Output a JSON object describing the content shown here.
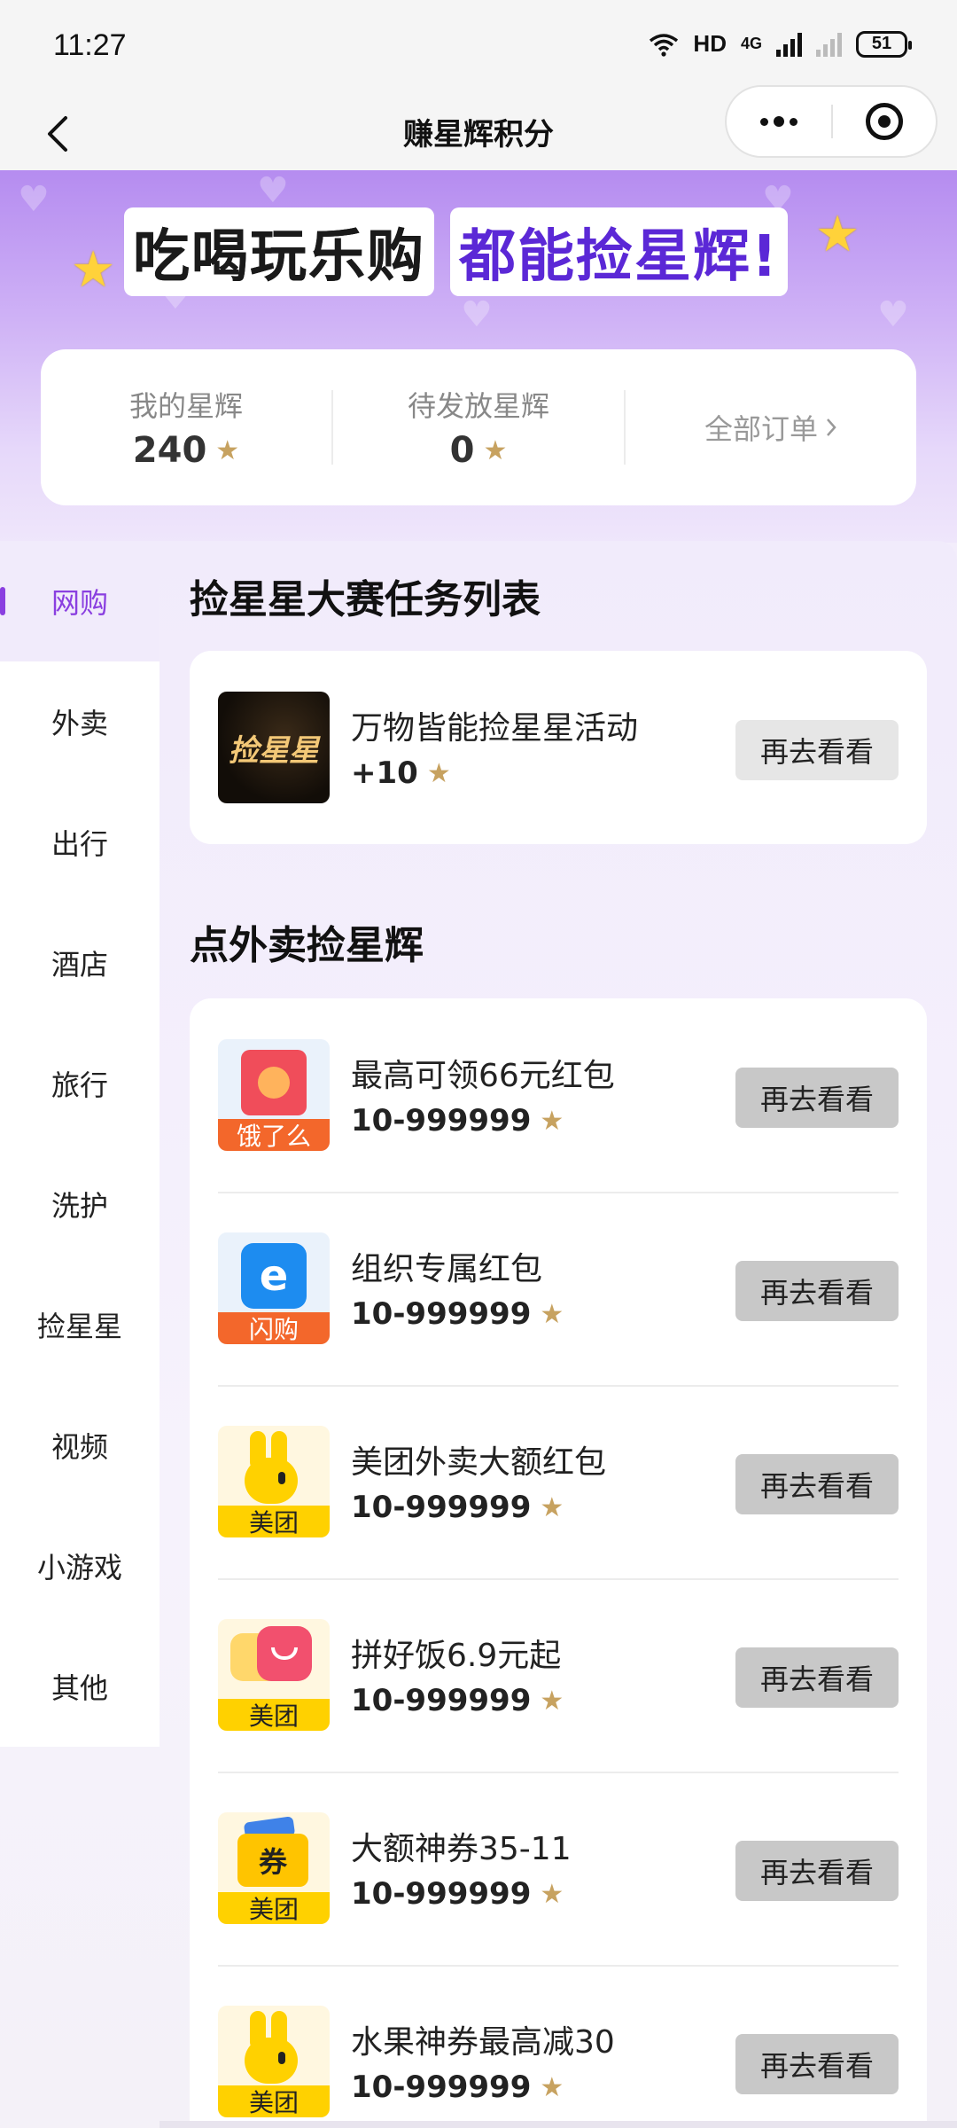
{
  "status_bar": {
    "time": "11:27",
    "network": "HD",
    "network_type": "4G",
    "battery": "51"
  },
  "nav": {
    "title": "赚星辉积分"
  },
  "banner": {
    "title_part1": "吃喝玩乐购",
    "title_part2": "都能捡星辉!"
  },
  "stats": {
    "my_label": "我的星辉",
    "my_value": "240",
    "pending_label": "待发放星辉",
    "pending_value": "0",
    "orders_label": "全部订单"
  },
  "sidebar": {
    "items": [
      {
        "label": "网购",
        "active": true
      },
      {
        "label": "外卖"
      },
      {
        "label": "出行"
      },
      {
        "label": "酒店"
      },
      {
        "label": "旅行"
      },
      {
        "label": "洗护"
      },
      {
        "label": "捡星星"
      },
      {
        "label": "视频"
      },
      {
        "label": "小游戏"
      },
      {
        "label": "其他"
      }
    ]
  },
  "sections": [
    {
      "title": "捡星星大赛任务列表",
      "tasks": [
        {
          "name": "万物皆能捡星星活动",
          "reward": "+10",
          "button": "再去看看",
          "logo_text": "捡星星"
        }
      ]
    },
    {
      "title": "点外卖捡星辉",
      "tasks": [
        {
          "name": "最高可领66元红包",
          "reward": "10-999999",
          "button": "再去看看",
          "logo_label": "饿了么"
        },
        {
          "name": "组织专属红包",
          "reward": "10-999999",
          "button": "再去看看",
          "logo_label": "闪购"
        },
        {
          "name": "美团外卖大额红包",
          "reward": "10-999999",
          "button": "再去看看",
          "logo_label": "美团"
        },
        {
          "name": "拼好饭6.9元起",
          "reward": "10-999999",
          "button": "再去看看",
          "logo_label": "美团"
        },
        {
          "name": "大额神券35-11",
          "reward": "10-999999",
          "button": "再去看看",
          "logo_label": "美团",
          "logo_glyph": "券"
        },
        {
          "name": "水果神券最高减30",
          "reward": "10-999999",
          "button": "再去看看",
          "logo_label": "美团"
        }
      ]
    }
  ],
  "colors": {
    "accent": "#8a3fe0",
    "gold": "#c7a260",
    "banner_top": "#b58cf0"
  },
  "icons": [
    "back-icon",
    "more-icon",
    "close-ring-icon",
    "star-icon",
    "chevron-right-icon",
    "wifi-icon",
    "battery-icon"
  ]
}
